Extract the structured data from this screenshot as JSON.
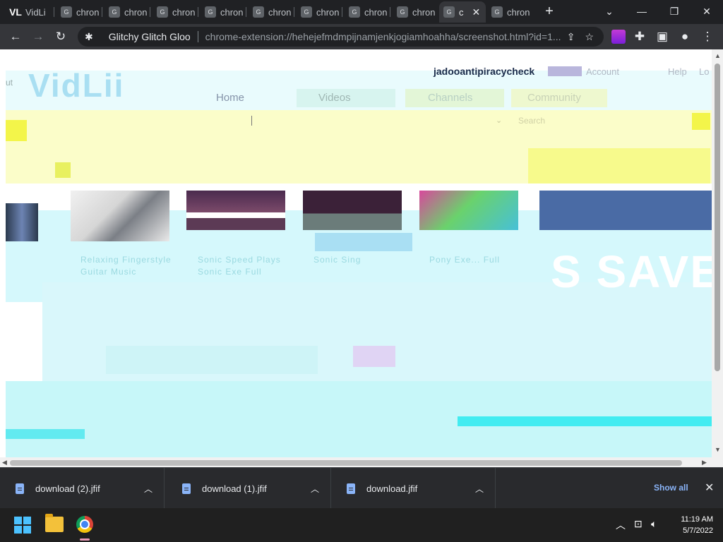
{
  "browser": {
    "tabs": [
      {
        "title": "VidLi",
        "icon": "vidlii-favicon"
      },
      {
        "title": "chron",
        "icon": "g-favicon"
      },
      {
        "title": "chron",
        "icon": "g-favicon"
      },
      {
        "title": "chron",
        "icon": "g-favicon"
      },
      {
        "title": "chron",
        "icon": "g-favicon"
      },
      {
        "title": "chron",
        "icon": "g-favicon"
      },
      {
        "title": "chron",
        "icon": "g-favicon"
      },
      {
        "title": "chron",
        "icon": "g-favicon"
      },
      {
        "title": "c",
        "icon": "g-favicon",
        "active": true
      },
      {
        "title": "chron",
        "icon": "g-favicon"
      }
    ],
    "favicon_letter": "G",
    "vidlii_favicon": "VL",
    "extension_name": "Glitchy Glitch Gloo",
    "url": "chrome-extension://hehejefmdmpijnamjenkjogiamhoahha/screenshot.html?id=1..."
  },
  "page": {
    "logo_text": "VidLii",
    "username": "jadooantipiracycheck",
    "header_links": [
      "Account",
      "Help",
      "Lo"
    ],
    "nav": [
      "Home",
      "Videos",
      "Channels",
      "Community"
    ],
    "search_placeholder": "Search",
    "left_cut_text": "ut",
    "videos": [
      {
        "title": "Relaxing Fingerstyle Guitar Music"
      },
      {
        "title": "Sonic Speed Plays Sonic Exe Full"
      },
      {
        "title": "Sonic Sing"
      },
      {
        "title": "Pony Exe... Full"
      }
    ],
    "banner_text": "S SAVE"
  },
  "downloads": {
    "items": [
      "download (2).jfif",
      "download (1).jfif",
      "download.jfif"
    ],
    "show_all": "Show all"
  },
  "taskbar": {
    "time": "11:19 AM",
    "date": "5/7/2022"
  },
  "colors": {
    "chrome_dark": "#202124",
    "chrome_toolbar": "#35363a",
    "glitch_cyan": "#cdf7fb",
    "glitch_yellow": "#fbfdc9",
    "link_blue": "#8ab4f8"
  }
}
